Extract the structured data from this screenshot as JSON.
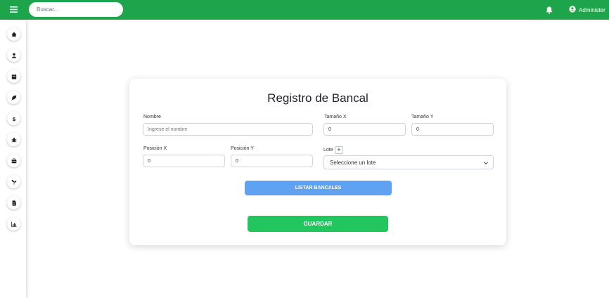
{
  "header": {
    "menu_icon": "hamburger-icon",
    "search_placeholder": "Buscar...",
    "notification_icon": "bell-icon",
    "user_icon": "user-circle-icon",
    "user_label": "Administer"
  },
  "sidebar": {
    "items": [
      {
        "name": "home",
        "icon": "home-icon"
      },
      {
        "name": "users",
        "icon": "user-icon"
      },
      {
        "name": "calendar",
        "icon": "calendar-icon"
      },
      {
        "name": "crops",
        "icon": "leaf-icon"
      },
      {
        "name": "finance",
        "icon": "dollar-icon"
      },
      {
        "name": "pests",
        "icon": "bug-icon"
      },
      {
        "name": "inventory",
        "icon": "toolbox-icon"
      },
      {
        "name": "seeds",
        "icon": "seedling-icon"
      },
      {
        "name": "reports",
        "icon": "file-icon"
      },
      {
        "name": "statistics",
        "icon": "chart-icon"
      }
    ]
  },
  "form": {
    "title": "Registro de Bancal",
    "nombre": {
      "label": "Nombre",
      "placeholder": "Ingrese el nombre",
      "value": ""
    },
    "tamano_x": {
      "label": "Tamaño X",
      "value": "0"
    },
    "tamano_y": {
      "label": "Tamaño Y",
      "value": "0"
    },
    "posicion_x": {
      "label": "Posición X",
      "value": "0"
    },
    "posicion_y": {
      "label": "Posición Y",
      "value": "0"
    },
    "lote": {
      "label": "Lote",
      "add_label": "+",
      "selected": "Seleccione un lote"
    },
    "list_button": "LISTAR BANCALES",
    "save_button": "GUARDAR"
  },
  "colors": {
    "topbar": "#1ea54b",
    "list_button": "#5fa2f2",
    "save_button": "#22c55e"
  }
}
